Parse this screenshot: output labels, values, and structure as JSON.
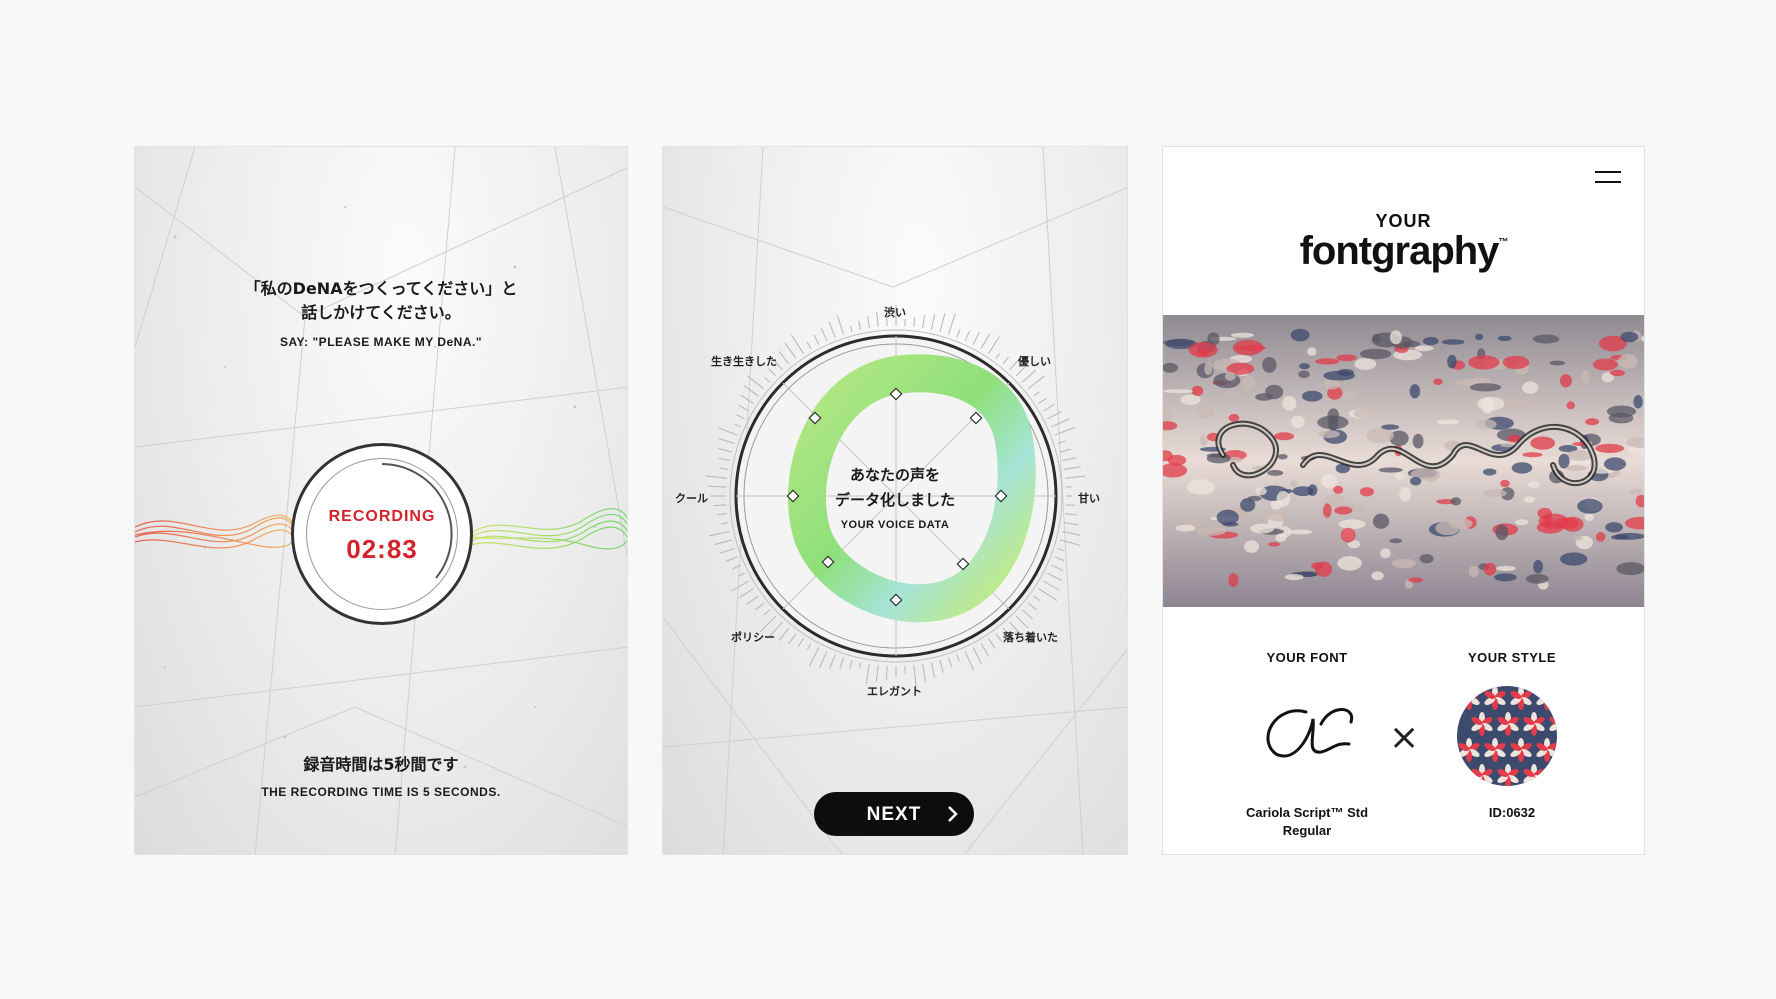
{
  "screens": {
    "recording": {
      "prompt_jp_line1": "「私のDeNAをつくってください」と",
      "prompt_jp_line2": "話しかけてください。",
      "prompt_en": "SAY: \"PLEASE MAKE MY DeNA.\"",
      "status_label": "RECORDING",
      "timer": "02:83",
      "footer_jp": "録音時間は5秒間です",
      "footer_en": "THE RECORDING TIME IS 5 SECONDS.",
      "colors": {
        "accent": "#d3232c",
        "wave_left": "#e8483a",
        "wave_right": "#5fd05a"
      }
    },
    "voice_data": {
      "dial_labels": {
        "top": "渋い",
        "top_right": "優しい",
        "right": "甘い",
        "bottom_right": "落ち着いた",
        "bottom": "エレガント",
        "bottom_left": "ポリシー",
        "left": "クール",
        "top_left": "生き生きした"
      },
      "center_jp_line1": "あなたの声を",
      "center_jp_line2": "データ化しました",
      "center_en": "YOUR VOICE DATA",
      "next_label": "NEXT",
      "next_icon": "chevron-right-icon",
      "colors": {
        "ring_green": "#8ee07a",
        "ring_teal": "#a6e4d6",
        "button": "#0d0d0d"
      }
    },
    "result": {
      "menu_icon": "hamburger-menu-icon",
      "eyebrow": "YOUR",
      "brand": "fontgraphy",
      "brand_mark": "™",
      "font_title": "YOUR FONT",
      "style_title": "YOUR STYLE",
      "times_symbol": "×",
      "font_name_line1": "Cariola Script™ Std",
      "font_name_line2": "Regular",
      "style_id": "ID:0632",
      "colors": {
        "pattern_red": "#e23b4a",
        "pattern_navy": "#3c4a6e",
        "pattern_cream": "#efe4dc"
      }
    }
  }
}
